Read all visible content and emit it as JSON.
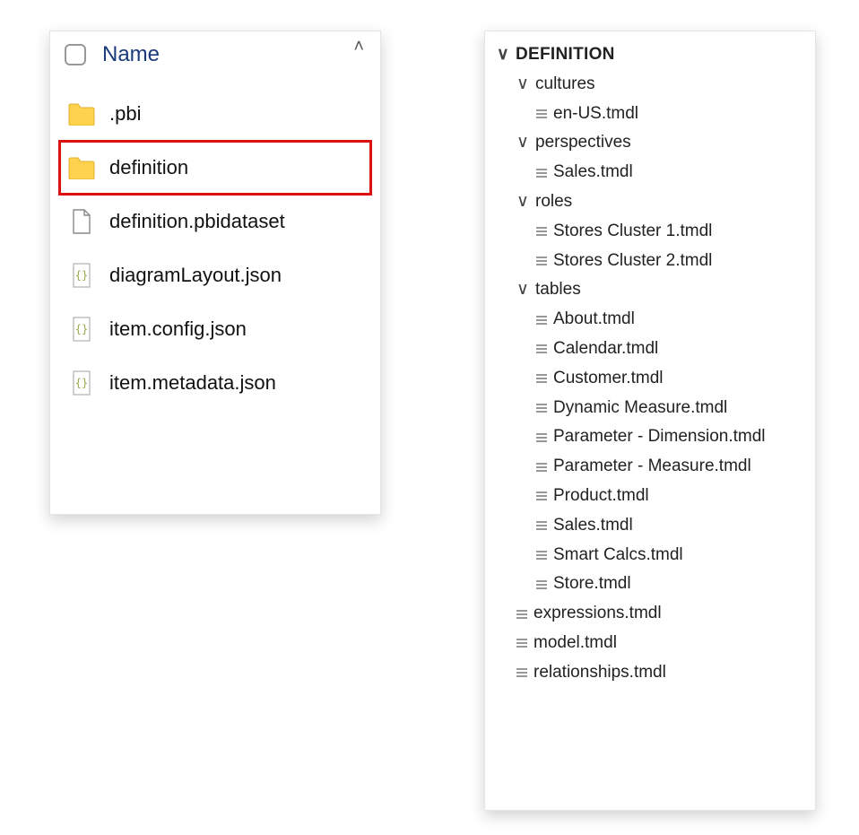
{
  "leftPanel": {
    "header": {
      "columnName": "Name"
    },
    "items": [
      {
        "type": "folder",
        "label": ".pbi",
        "hl": false
      },
      {
        "type": "folder",
        "label": "definition",
        "hl": true
      },
      {
        "type": "file",
        "label": "definition.pbidataset"
      },
      {
        "type": "json",
        "label": "diagramLayout.json"
      },
      {
        "type": "json",
        "label": "item.config.json"
      },
      {
        "type": "json",
        "label": "item.metadata.json"
      }
    ]
  },
  "tree": {
    "root": "DEFINITION",
    "folders": [
      {
        "name": "cultures",
        "files": [
          "en-US.tmdl"
        ]
      },
      {
        "name": "perspectives",
        "files": [
          "Sales.tmdl"
        ]
      },
      {
        "name": "roles",
        "files": [
          "Stores Cluster 1.tmdl",
          "Stores Cluster 2.tmdl"
        ]
      },
      {
        "name": "tables",
        "files": [
          "About.tmdl",
          "Calendar.tmdl",
          "Customer.tmdl",
          "Dynamic Measure.tmdl",
          "Parameter - Dimension.tmdl",
          "Parameter - Measure.tmdl",
          "Product.tmdl",
          "Sales.tmdl",
          "Smart Calcs.tmdl",
          "Store.tmdl"
        ]
      }
    ],
    "rootFiles": [
      "expressions.tmdl",
      "model.tmdl",
      "relationships.tmdl"
    ]
  }
}
